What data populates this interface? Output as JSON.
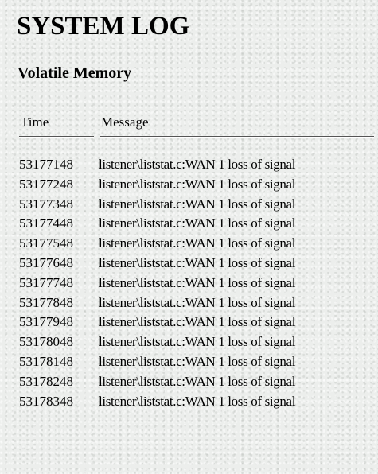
{
  "page": {
    "title": "SYSTEM LOG",
    "subtitle": "Volatile Memory"
  },
  "table": {
    "headers": {
      "time": "Time",
      "message": "Message"
    },
    "rows": [
      {
        "time": "53177148",
        "message": "listener\\liststat.c:WAN 1 loss of signal"
      },
      {
        "time": "53177248",
        "message": "listener\\liststat.c:WAN 1 loss of signal"
      },
      {
        "time": "53177348",
        "message": "listener\\liststat.c:WAN 1 loss of signal"
      },
      {
        "time": "53177448",
        "message": "listener\\liststat.c:WAN 1 loss of signal"
      },
      {
        "time": "53177548",
        "message": "listener\\liststat.c:WAN 1 loss of signal"
      },
      {
        "time": "53177648",
        "message": "listener\\liststat.c:WAN 1 loss of signal"
      },
      {
        "time": "53177748",
        "message": "listener\\liststat.c:WAN 1 loss of signal"
      },
      {
        "time": "53177848",
        "message": "listener\\liststat.c:WAN 1 loss of signal"
      },
      {
        "time": "53177948",
        "message": "listener\\liststat.c:WAN 1 loss of signal"
      },
      {
        "time": "53178048",
        "message": "listener\\liststat.c:WAN 1 loss of signal"
      },
      {
        "time": "53178148",
        "message": "listener\\liststat.c:WAN 1 loss of signal"
      },
      {
        "time": "53178248",
        "message": "listener\\liststat.c:WAN 1 loss of signal"
      },
      {
        "time": "53178348",
        "message": "listener\\liststat.c:WAN 1 loss of signal"
      }
    ]
  }
}
